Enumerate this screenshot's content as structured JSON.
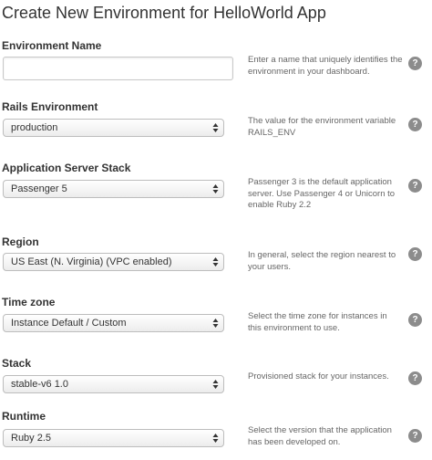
{
  "header": {
    "title": "Create New Environment for HelloWorld App"
  },
  "fields": [
    {
      "label": "Environment Name",
      "type": "text",
      "value": "",
      "help": "Enter a name that uniquely identifies the environment in your dashboard.",
      "help_icon": "?"
    },
    {
      "label": "Rails Environment",
      "type": "select",
      "value": "production",
      "help": "The value for the environment variable RAILS_ENV",
      "help_icon": "?"
    },
    {
      "label": "Application Server Stack",
      "type": "select",
      "value": "Passenger 5",
      "help": "Passenger 3 is the default application server. Use Passenger 4 or Unicorn to enable Ruby 2.2",
      "help_icon": "?"
    },
    {
      "label": "Region",
      "type": "select",
      "value": "US East (N. Virginia) (VPC enabled)",
      "help": "In general, select the region nearest to your users.",
      "help_icon": "?"
    },
    {
      "label": "Time zone",
      "type": "select",
      "value": "Instance Default / Custom",
      "help": "Select the time zone for instances in this environment to use.",
      "help_icon": "?"
    },
    {
      "label": "Stack",
      "type": "select",
      "value": "stable-v6 1.0",
      "help": "Provisioned stack for your instances.",
      "help_icon": "?"
    },
    {
      "label": "Runtime",
      "type": "select",
      "value": "Ruby 2.5",
      "help": "Select the version that the application has been developed on.",
      "help_icon": "?"
    }
  ]
}
